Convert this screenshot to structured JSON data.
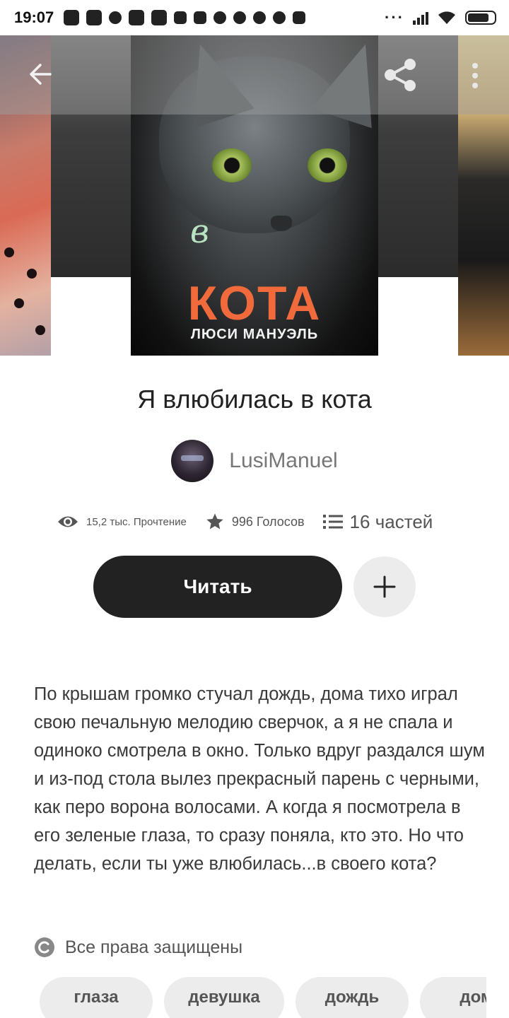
{
  "status_bar": {
    "time": "19:07",
    "more_dots": "···"
  },
  "cover": {
    "letter": "в",
    "title": "КОТА",
    "author": "ЛЮСИ МАНУЭЛЬ"
  },
  "toolbar": {
    "back_icon": "arrow-left-icon",
    "share_icon": "share-icon",
    "more_icon": "more-vertical-icon"
  },
  "story": {
    "title": "Я влюбилась в кота",
    "author": "LusiManuel",
    "stats": {
      "reads": "15,2 тыс. Прочтение",
      "votes": "996 Голосов",
      "parts": "16 частей"
    },
    "read_button": "Читать",
    "add_icon": "plus-icon",
    "description": "По крышам громко стучал дождь, дома тихо играл свою печальную мелодию сверчок, а я не спала и одиноко смотрела в окно. Только вдруг раздался шум и из-под стола вылез прекрасный парень с черными, как перо ворона волосами. А когда я посмотрела в его зеленые глаза, то сразу поняла, кто это. Но что делать, если ты уже влюбилась...в своего кота?",
    "copyright": "Все права защищены",
    "tags": [
      "глаза",
      "девушка",
      "дождь",
      "дом"
    ]
  },
  "colors": {
    "button_dark": "#222222",
    "cover_title_orange": "#f16a3b",
    "chip_bg": "#ececec"
  }
}
